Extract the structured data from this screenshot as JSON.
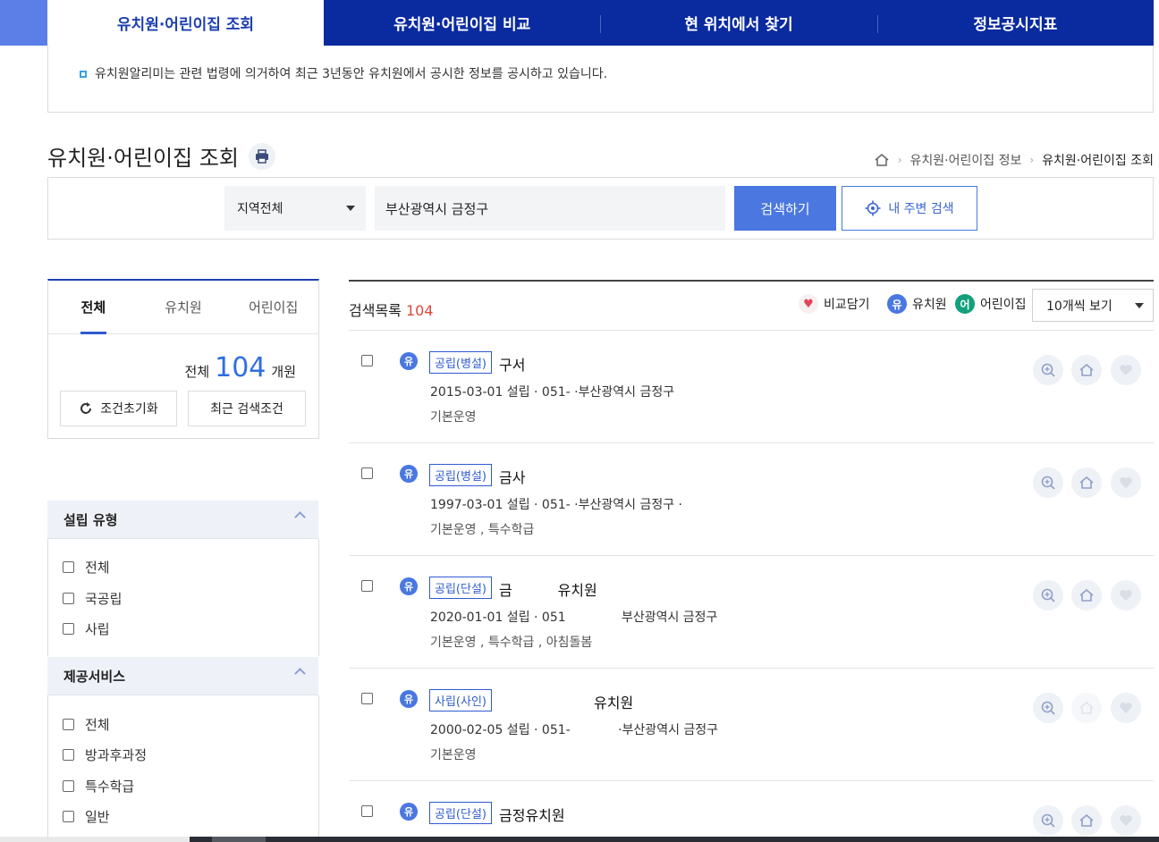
{
  "top_tabs": [
    {
      "label": "유치원·어린이집 조회"
    },
    {
      "label": "유치원·어린이집 비교"
    },
    {
      "label": "현 위치에서 찾기"
    },
    {
      "label": "정보공시지표"
    }
  ],
  "notice": "유치원알리미는 관련 법령에 의거하여 최근 3년동안 유치원에서 공시한 정보를 공시하고 있습니다.",
  "page_title": "유치원·어린이집 조회",
  "breadcrumb": {
    "level1": "유치원·어린이집 정보",
    "current": "유치원·어린이집 조회"
  },
  "search": {
    "region": "지역전체",
    "address": "부산광역시 금정구",
    "search_label": "검색하기",
    "near_label": "내 주변 검색"
  },
  "left": {
    "tabs": [
      "전체",
      "유치원",
      "어린이집"
    ],
    "count_prefix": "전체",
    "count": "104",
    "count_suffix": "개원",
    "reset_label": "조건초기화",
    "recent_label": "최근 검색조건"
  },
  "filters": [
    {
      "title": "설립 유형",
      "options": [
        "전체",
        "국공립",
        "사립"
      ]
    },
    {
      "title": "제공서비스",
      "options": [
        "전체",
        "방과후과정",
        "특수학급",
        "일반"
      ]
    }
  ],
  "results": {
    "label": "검색목록",
    "count": "104",
    "legend_compare": "비교담기",
    "legend_yu_mark": "유",
    "legend_yu": "유치원",
    "legend_eo_mark": "어",
    "legend_eo": "어린이집",
    "page_size": "10개씩 보기"
  },
  "items": [
    {
      "type_mark": "유",
      "badge": "공립(병설)",
      "name": "구서",
      "meta": "2015-03-01 설립 · 051-            ·부산광역시 금정구",
      "services": "기본운영"
    },
    {
      "type_mark": "유",
      "badge": "공립(병설)",
      "name": "금사",
      "meta": "1997-03-01 설립 · 051-            ·부산광역시 금정구 ·",
      "services": "기본운영 , 특수학급"
    },
    {
      "type_mark": "유",
      "badge": "공립(단설)",
      "name": "금          유치원",
      "meta": "2020-01-01 설립 · 051              부산광역시 금정구",
      "services": "기본운영 , 특수학급 , 아침돌봄"
    },
    {
      "type_mark": "유",
      "badge": "사립(사인)",
      "name": "유치원",
      "meta": "2000-02-05 설립 · 051-            ·부산광역시 금정구",
      "services": "기본운영"
    },
    {
      "type_mark": "유",
      "badge": "공립(단설)",
      "name": "금정유치원",
      "meta": "",
      "services": ""
    }
  ],
  "colors": {
    "nav_dark": "#0a2aa0",
    "accent_blue": "#4a77e0",
    "count_red": "#e2463a",
    "daycare_green": "#13a07c"
  }
}
